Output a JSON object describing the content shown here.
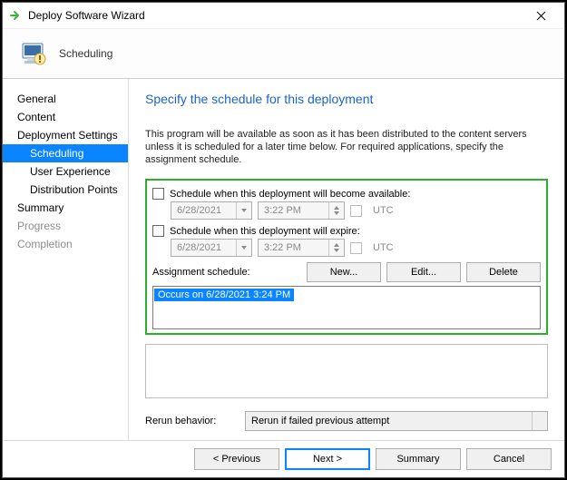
{
  "window": {
    "title": "Deploy Software Wizard"
  },
  "header": {
    "label": "Scheduling"
  },
  "sidebar": {
    "items": [
      {
        "label": "General",
        "sub": false,
        "selected": false,
        "disabled": false
      },
      {
        "label": "Content",
        "sub": false,
        "selected": false,
        "disabled": false
      },
      {
        "label": "Deployment Settings",
        "sub": false,
        "selected": false,
        "disabled": false
      },
      {
        "label": "Scheduling",
        "sub": true,
        "selected": true,
        "disabled": false
      },
      {
        "label": "User Experience",
        "sub": true,
        "selected": false,
        "disabled": false
      },
      {
        "label": "Distribution Points",
        "sub": true,
        "selected": false,
        "disabled": false
      },
      {
        "label": "Summary",
        "sub": false,
        "selected": false,
        "disabled": false
      },
      {
        "label": "Progress",
        "sub": false,
        "selected": false,
        "disabled": true
      },
      {
        "label": "Completion",
        "sub": false,
        "selected": false,
        "disabled": true
      }
    ]
  },
  "main": {
    "title": "Specify the schedule for this deployment",
    "intro": "This program will be available as soon as it has been distributed to the content servers unless it is scheduled for a later time below. For required applications, specify the assignment schedule.",
    "avail": {
      "label": "Schedule when this deployment will become available:",
      "date": "6/28/2021",
      "time": "3:22 PM",
      "utc": "UTC"
    },
    "expire": {
      "label": "Schedule when this deployment will expire:",
      "date": "6/28/2021",
      "time": "3:22 PM",
      "utc": "UTC"
    },
    "assign": {
      "label": "Assignment schedule:",
      "new": "New...",
      "edit": "Edit...",
      "delete": "Delete",
      "item": "Occurs on 6/28/2021 3:24 PM"
    },
    "rerun": {
      "label": "Rerun behavior:",
      "value": "Rerun if failed previous attempt"
    }
  },
  "footer": {
    "previous": "< Previous",
    "next": "Next >",
    "summary": "Summary",
    "cancel": "Cancel"
  }
}
